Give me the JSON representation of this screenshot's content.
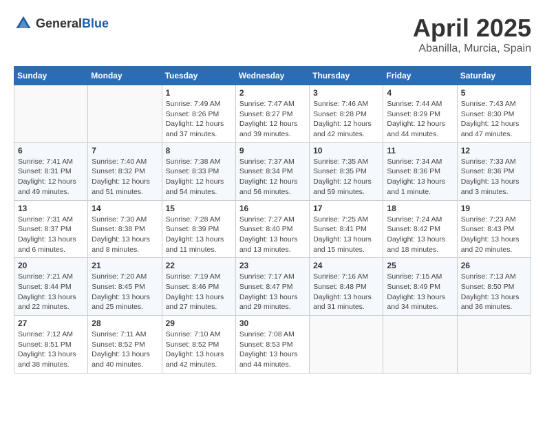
{
  "header": {
    "logo_general": "General",
    "logo_blue": "Blue",
    "month_title": "April 2025",
    "location": "Abanilla, Murcia, Spain"
  },
  "calendar": {
    "days_of_week": [
      "Sunday",
      "Monday",
      "Tuesday",
      "Wednesday",
      "Thursday",
      "Friday",
      "Saturday"
    ],
    "weeks": [
      [
        {
          "day": "",
          "info": ""
        },
        {
          "day": "",
          "info": ""
        },
        {
          "day": "1",
          "info": "Sunrise: 7:49 AM\nSunset: 8:26 PM\nDaylight: 12 hours and 37 minutes."
        },
        {
          "day": "2",
          "info": "Sunrise: 7:47 AM\nSunset: 8:27 PM\nDaylight: 12 hours and 39 minutes."
        },
        {
          "day": "3",
          "info": "Sunrise: 7:46 AM\nSunset: 8:28 PM\nDaylight: 12 hours and 42 minutes."
        },
        {
          "day": "4",
          "info": "Sunrise: 7:44 AM\nSunset: 8:29 PM\nDaylight: 12 hours and 44 minutes."
        },
        {
          "day": "5",
          "info": "Sunrise: 7:43 AM\nSunset: 8:30 PM\nDaylight: 12 hours and 47 minutes."
        }
      ],
      [
        {
          "day": "6",
          "info": "Sunrise: 7:41 AM\nSunset: 8:31 PM\nDaylight: 12 hours and 49 minutes."
        },
        {
          "day": "7",
          "info": "Sunrise: 7:40 AM\nSunset: 8:32 PM\nDaylight: 12 hours and 51 minutes."
        },
        {
          "day": "8",
          "info": "Sunrise: 7:38 AM\nSunset: 8:33 PM\nDaylight: 12 hours and 54 minutes."
        },
        {
          "day": "9",
          "info": "Sunrise: 7:37 AM\nSunset: 8:34 PM\nDaylight: 12 hours and 56 minutes."
        },
        {
          "day": "10",
          "info": "Sunrise: 7:35 AM\nSunset: 8:35 PM\nDaylight: 12 hours and 59 minutes."
        },
        {
          "day": "11",
          "info": "Sunrise: 7:34 AM\nSunset: 8:36 PM\nDaylight: 13 hours and 1 minute."
        },
        {
          "day": "12",
          "info": "Sunrise: 7:33 AM\nSunset: 8:36 PM\nDaylight: 13 hours and 3 minutes."
        }
      ],
      [
        {
          "day": "13",
          "info": "Sunrise: 7:31 AM\nSunset: 8:37 PM\nDaylight: 13 hours and 6 minutes."
        },
        {
          "day": "14",
          "info": "Sunrise: 7:30 AM\nSunset: 8:38 PM\nDaylight: 13 hours and 8 minutes."
        },
        {
          "day": "15",
          "info": "Sunrise: 7:28 AM\nSunset: 8:39 PM\nDaylight: 13 hours and 11 minutes."
        },
        {
          "day": "16",
          "info": "Sunrise: 7:27 AM\nSunset: 8:40 PM\nDaylight: 13 hours and 13 minutes."
        },
        {
          "day": "17",
          "info": "Sunrise: 7:25 AM\nSunset: 8:41 PM\nDaylight: 13 hours and 15 minutes."
        },
        {
          "day": "18",
          "info": "Sunrise: 7:24 AM\nSunset: 8:42 PM\nDaylight: 13 hours and 18 minutes."
        },
        {
          "day": "19",
          "info": "Sunrise: 7:23 AM\nSunset: 8:43 PM\nDaylight: 13 hours and 20 minutes."
        }
      ],
      [
        {
          "day": "20",
          "info": "Sunrise: 7:21 AM\nSunset: 8:44 PM\nDaylight: 13 hours and 22 minutes."
        },
        {
          "day": "21",
          "info": "Sunrise: 7:20 AM\nSunset: 8:45 PM\nDaylight: 13 hours and 25 minutes."
        },
        {
          "day": "22",
          "info": "Sunrise: 7:19 AM\nSunset: 8:46 PM\nDaylight: 13 hours and 27 minutes."
        },
        {
          "day": "23",
          "info": "Sunrise: 7:17 AM\nSunset: 8:47 PM\nDaylight: 13 hours and 29 minutes."
        },
        {
          "day": "24",
          "info": "Sunrise: 7:16 AM\nSunset: 8:48 PM\nDaylight: 13 hours and 31 minutes."
        },
        {
          "day": "25",
          "info": "Sunrise: 7:15 AM\nSunset: 8:49 PM\nDaylight: 13 hours and 34 minutes."
        },
        {
          "day": "26",
          "info": "Sunrise: 7:13 AM\nSunset: 8:50 PM\nDaylight: 13 hours and 36 minutes."
        }
      ],
      [
        {
          "day": "27",
          "info": "Sunrise: 7:12 AM\nSunset: 8:51 PM\nDaylight: 13 hours and 38 minutes."
        },
        {
          "day": "28",
          "info": "Sunrise: 7:11 AM\nSunset: 8:52 PM\nDaylight: 13 hours and 40 minutes."
        },
        {
          "day": "29",
          "info": "Sunrise: 7:10 AM\nSunset: 8:52 PM\nDaylight: 13 hours and 42 minutes."
        },
        {
          "day": "30",
          "info": "Sunrise: 7:08 AM\nSunset: 8:53 PM\nDaylight: 13 hours and 44 minutes."
        },
        {
          "day": "",
          "info": ""
        },
        {
          "day": "",
          "info": ""
        },
        {
          "day": "",
          "info": ""
        }
      ]
    ]
  }
}
